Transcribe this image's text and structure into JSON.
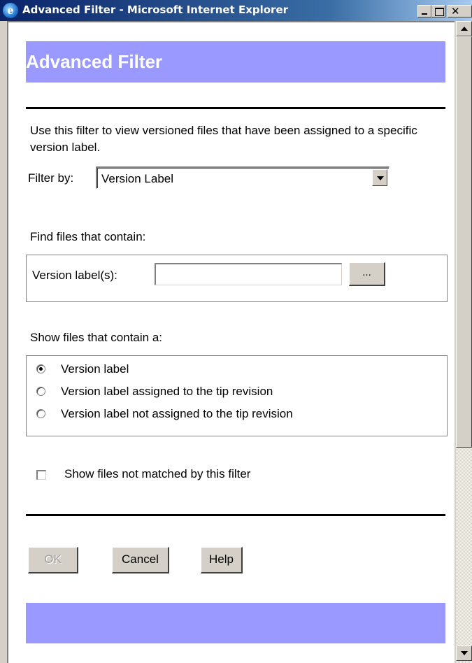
{
  "window": {
    "title": "Advanced Filter - Microsoft Internet Explorer",
    "icon": "ie-icon",
    "controls": {
      "minimize": "minimize-icon",
      "maximize": "maximize-icon",
      "close": "✕"
    }
  },
  "header": {
    "title": "Advanced Filter",
    "bar_color": "#9999ff"
  },
  "description": "Use this filter to view versioned files that have been assigned to a specific version label.",
  "filter": {
    "label": "Filter by:",
    "selected": "Version Label"
  },
  "find": {
    "section_label": "Find files that contain:",
    "field_label": "Version label(s):",
    "value": "",
    "browse_label": "..."
  },
  "show": {
    "section_label": "Show files that contain a:",
    "options": [
      {
        "label": "Version label",
        "checked": true
      },
      {
        "label": "Version label assigned to the tip revision",
        "checked": false
      },
      {
        "label": "Version label not assigned to the tip revision",
        "checked": false
      }
    ]
  },
  "unmatched": {
    "label": "Show files not matched by this filter",
    "checked": false
  },
  "buttons": {
    "ok": "OK",
    "cancel": "Cancel",
    "help": "Help"
  }
}
